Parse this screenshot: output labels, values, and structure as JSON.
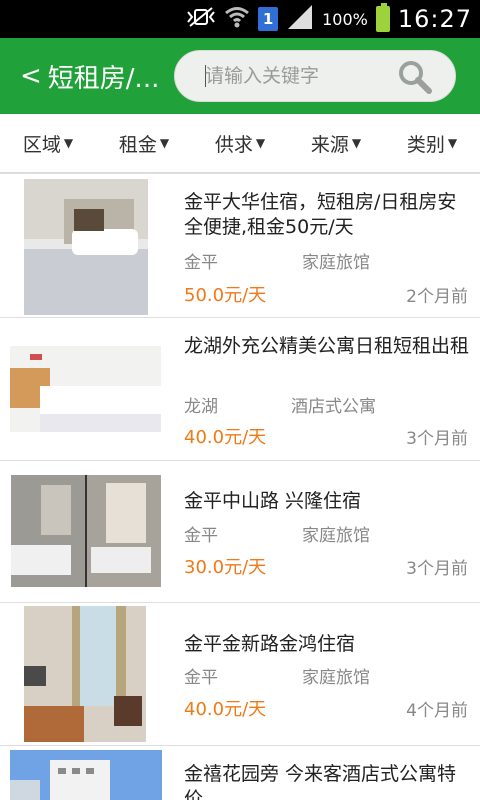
{
  "status_bar": {
    "sim_slot": "1",
    "battery_pct": "100%",
    "clock": "16:27"
  },
  "header": {
    "back_title": "短租房/...",
    "search_placeholder": "请输入关键字"
  },
  "filters": [
    "区域",
    "租金",
    "供求",
    "来源",
    "类别"
  ],
  "listings": [
    {
      "title": "金平大华住宿，短租房/日租房安全便捷,租金50元/天",
      "area": "金平",
      "type": "家庭旅馆",
      "price": "50.0元/天",
      "time": "2个月前",
      "image": "room-photo"
    },
    {
      "title": "龙湖外充公精美公寓日租短租出租",
      "area": "龙湖",
      "type": "酒店式公寓",
      "price": "40.0元/天",
      "time": "3个月前",
      "image": "room-photo"
    },
    {
      "title": "金平中山路 兴隆住宿",
      "area": "金平",
      "type": "家庭旅馆",
      "price": "30.0元/天",
      "time": "3个月前",
      "image": "room-photo"
    },
    {
      "title": "金平金新路金鸿住宿",
      "area": "金平",
      "type": "家庭旅馆",
      "price": "40.0元/天",
      "time": "4个月前",
      "image": "room-photo"
    },
    {
      "title": "金禧花园旁 今来客酒店式公寓特价",
      "image": "building-photo"
    }
  ]
}
